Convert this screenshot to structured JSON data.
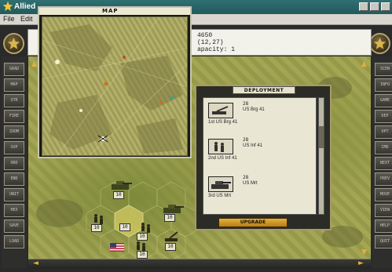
{
  "window": {
    "title": "Allied",
    "menu": [
      "File",
      "Edit"
    ]
  },
  "info": {
    "line1": "4650",
    "line2": "(12,27)",
    "line3": "apacity: 1"
  },
  "map_window": {
    "title": "MAP"
  },
  "deployment": {
    "title": "DEPLOYMENT",
    "units": [
      {
        "number": "28",
        "name": "US Brg 41",
        "label": "1st US Brg 41"
      },
      {
        "number": "28",
        "name": "US Inf 41",
        "label": "2nd US Inf 41"
      },
      {
        "number": "28",
        "name": "US Mrt",
        "label": "3rd US Mrt"
      }
    ],
    "upgrade_label": "UPGRADE"
  },
  "left_buttons": [
    "GRAD",
    "MAP",
    "STR",
    "FIRE",
    "ZOOM",
    "SUP",
    "ORD",
    "END",
    "UNIT",
    "HEX",
    "SAVE",
    "LOAD"
  ],
  "right_buttons": [
    "SCEN",
    "INFO",
    "GAME",
    "DEP",
    "OPT",
    "CMD",
    "NEXT",
    "PREV",
    "MOVE",
    "VIEW",
    "HELP",
    "QUIT"
  ],
  "terrain_counters": [
    "10",
    "10",
    "10",
    "10",
    "10",
    "10",
    "10"
  ],
  "colors": {
    "title_bar": "#2f6f72",
    "terrain": "#9a9c4c",
    "panel": "#2c2c26",
    "accent": "#e3b23a"
  }
}
